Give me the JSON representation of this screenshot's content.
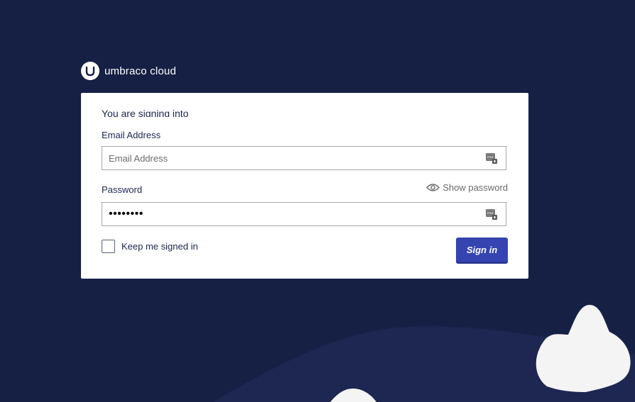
{
  "brand": {
    "name": "umbraco cloud"
  },
  "login": {
    "intro_text": "You are signing into",
    "email_label": "Email Address",
    "email_placeholder": "Email Address",
    "email_value": "",
    "password_label": "Password",
    "password_value": "••••••••",
    "show_password_label": "Show password",
    "keep_signed_in_label": "Keep me signed in",
    "keep_signed_in_checked": false,
    "sign_in_label": "Sign in"
  },
  "colors": {
    "background": "#162045",
    "card": "#ffffff",
    "primary_button": "#3544b1",
    "text": "#1b264f"
  }
}
